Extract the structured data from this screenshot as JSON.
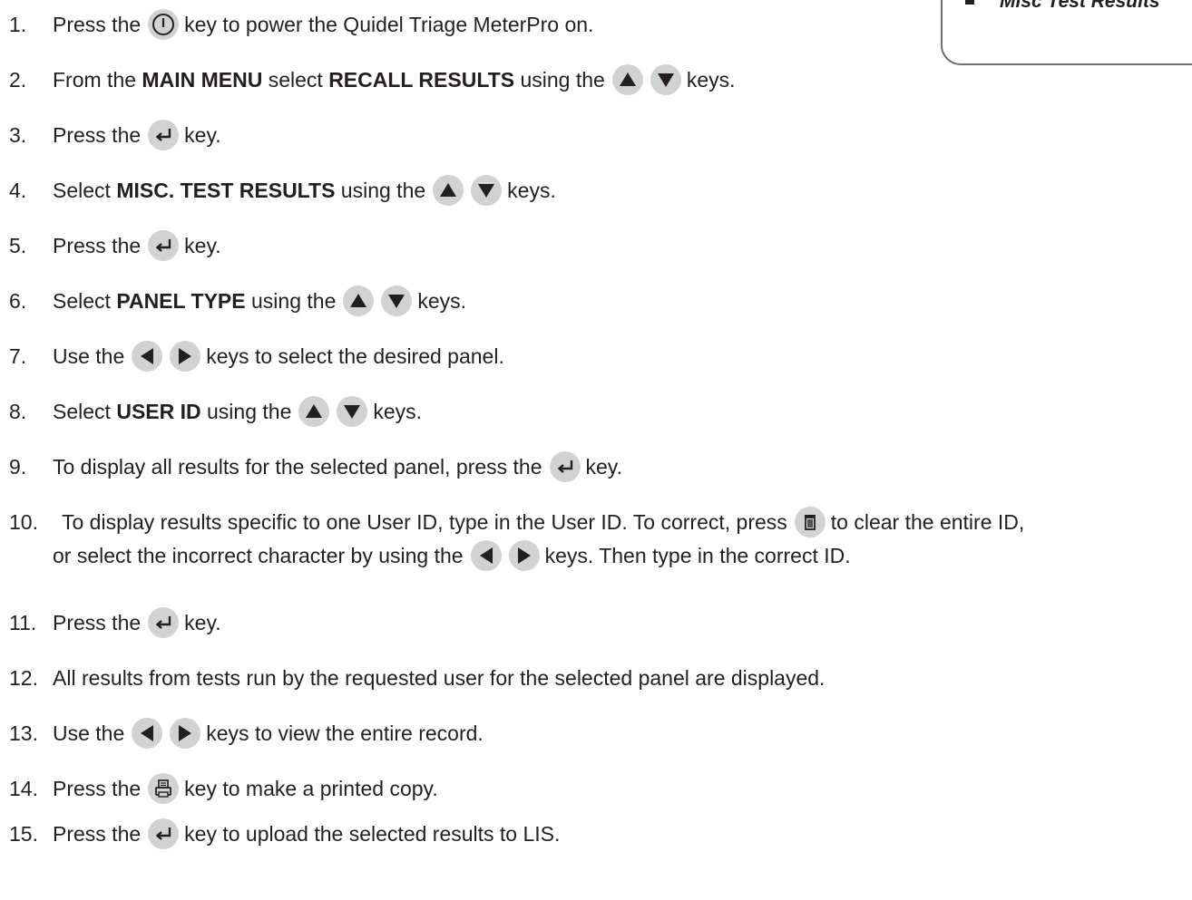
{
  "callout": {
    "item": "Misc Test Results"
  },
  "steps": [
    {
      "num": "1.",
      "a": "Press the",
      "b": "key to power the Quidel Triage MeterPro on."
    },
    {
      "num": "2.",
      "a": "From the ",
      "bold1": "MAIN MENU",
      "c": " select ",
      "bold2": "RECALL RESULTS",
      "d": " using the",
      "e": "keys."
    },
    {
      "num": "3.",
      "a": "Press the",
      "b": "key."
    },
    {
      "num": "4.",
      "a": "Select ",
      "bold1": "MISC. TEST RESULTS",
      "c": " using the",
      "e": "keys."
    },
    {
      "num": "5.",
      "a": "Press the",
      "b": "key."
    },
    {
      "num": "6.",
      "a": "Select ",
      "bold1": "PANEL TYPE",
      "c": " using the",
      "e": "keys."
    },
    {
      "num": "7.",
      "a": "Use the",
      "b": "keys to select the desired panel."
    },
    {
      "num": "8.",
      "a": "Select ",
      "bold1": "USER ID",
      "c": " using the",
      "e": "keys."
    },
    {
      "num": "9.",
      "a": "To display all results for the selected panel, press the",
      "b": "key."
    },
    {
      "num": "10.",
      "a": "To display results specific to one User ID, type in the User ID. To correct, press",
      "b": "to clear the entire ID,",
      "line2a": "or select the incorrect character by using the",
      "line2b": "keys. Then type in the correct ID."
    },
    {
      "num": "11.",
      "a": "Press the",
      "b": "key."
    },
    {
      "num": "12.",
      "a": "All results from tests run by the requested user for the selected panel are displayed."
    },
    {
      "num": "13.",
      "a": "Use the",
      "b": "keys to view the entire record."
    },
    {
      "num": "14.",
      "a": "Press the",
      "b": "key to make a printed copy."
    },
    {
      "num": "15.",
      "a": "Press the",
      "b": "key to upload the selected results to LIS."
    }
  ],
  "icons": {
    "power": "power-icon",
    "up": "up-arrow-icon",
    "down": "down-arrow-icon",
    "enter": "enter-icon",
    "left": "left-arrow-icon",
    "right": "right-arrow-icon",
    "trash": "trash-icon",
    "print": "print-icon"
  },
  "colors": {
    "key_fill": "#d0d2d3",
    "glyph": "#231f20",
    "border": "#6d6e71"
  }
}
